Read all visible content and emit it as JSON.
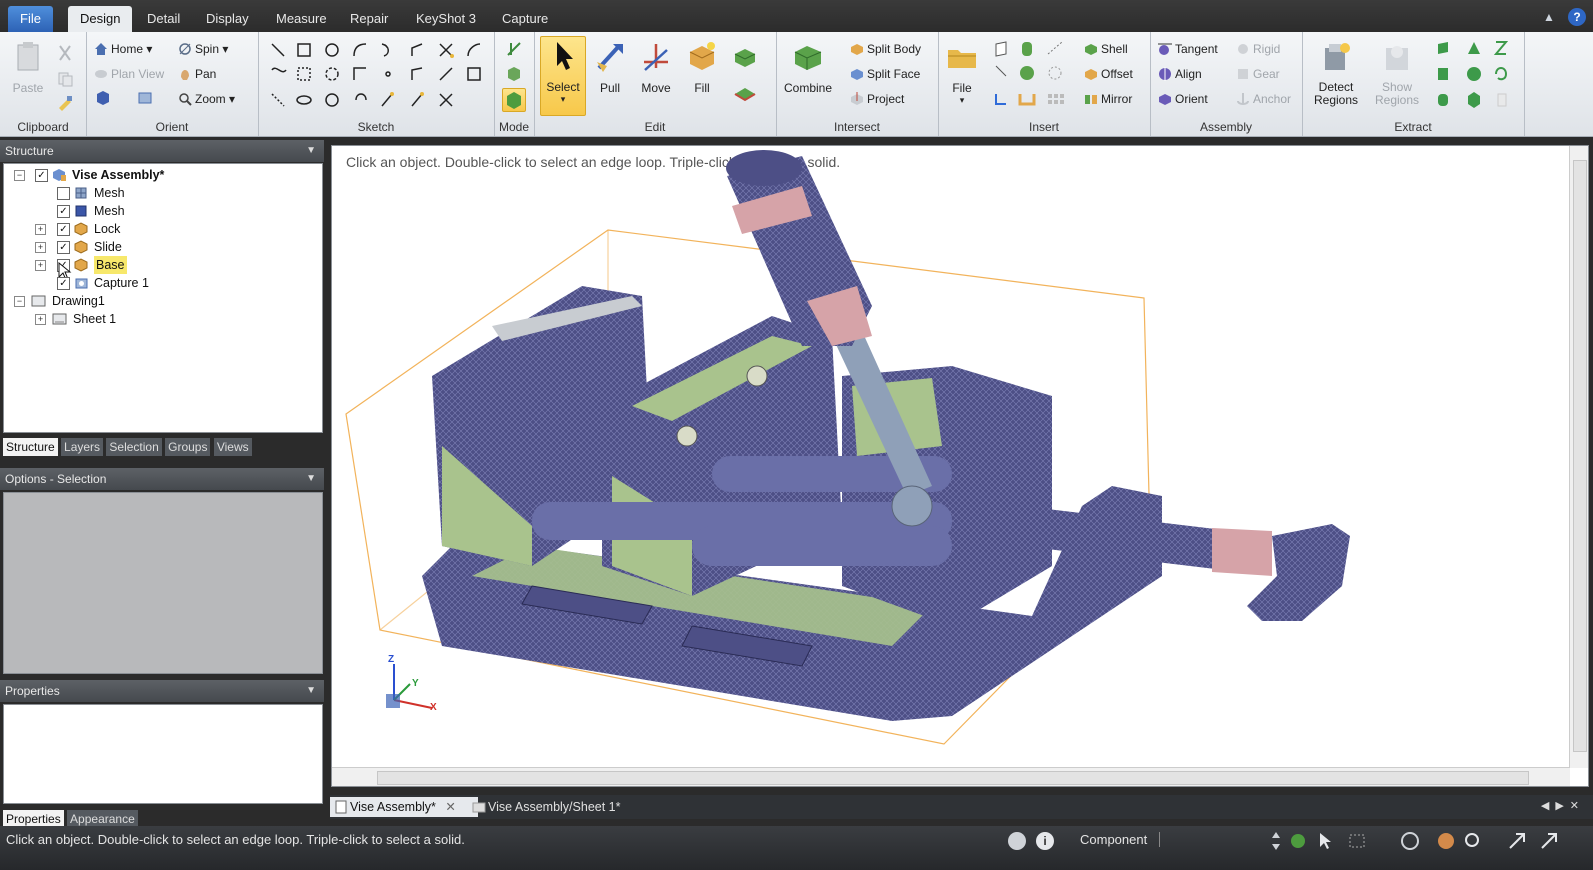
{
  "menu": {
    "tabs": [
      "File",
      "Design",
      "Detail",
      "Display",
      "Measure",
      "Repair",
      "KeyShot 3",
      "Capture"
    ],
    "active": "Design"
  },
  "ribbon": {
    "clipboard": {
      "label": "Clipboard",
      "paste": "Paste"
    },
    "orient": {
      "label": "Orient",
      "home": "Home",
      "spin": "Spin",
      "plan_view": "Plan View",
      "pan": "Pan",
      "zoom": "Zoom"
    },
    "sketch": {
      "label": "Sketch"
    },
    "mode": {
      "label": "Mode"
    },
    "edit": {
      "label": "Edit",
      "select": "Select",
      "pull": "Pull",
      "move": "Move",
      "fill": "Fill"
    },
    "intersect": {
      "label": "Intersect",
      "combine": "Combine",
      "split_body": "Split Body",
      "split_face": "Split Face",
      "project": "Project"
    },
    "insert": {
      "label": "Insert",
      "file": "File",
      "shell": "Shell",
      "offset": "Offset",
      "mirror": "Mirror"
    },
    "assembly": {
      "label": "Assembly",
      "tangent": "Tangent",
      "align": "Align",
      "orient": "Orient",
      "rigid": "Rigid",
      "gear": "Gear",
      "anchor": "Anchor"
    },
    "extract": {
      "label": "Extract",
      "detect_regions": "Detect Regions",
      "show_regions": "Show Regions"
    }
  },
  "structure_panel": {
    "title": "Structure",
    "tree": [
      {
        "label": "Vise Assembly*",
        "bold": true
      },
      {
        "label": "Mesh"
      },
      {
        "label": "Mesh"
      },
      {
        "label": "Lock"
      },
      {
        "label": "Slide"
      },
      {
        "label": "Base",
        "highlighted": true
      },
      {
        "label": "Capture 1"
      },
      {
        "label": "Drawing1"
      },
      {
        "label": "Sheet 1"
      }
    ],
    "tabs": [
      "Structure",
      "Layers",
      "Selection",
      "Groups",
      "Views"
    ]
  },
  "options_panel": {
    "title": "Options - Selection"
  },
  "properties_panel": {
    "title": "Properties",
    "tabs": [
      "Properties",
      "Appearance"
    ]
  },
  "viewport": {
    "hint": "Click an object. Double-click to select an edge loop. Triple-click to select a solid.",
    "axes": {
      "z": "Z",
      "y": "Y",
      "x": "X"
    }
  },
  "doc_tabs": [
    "Vise Assembly*",
    "Vise Assembly/Sheet 1*"
  ],
  "statusbar": {
    "message": "Click an object. Double-click to select an edge loop. Triple-click to select a solid.",
    "filter": "Component"
  },
  "colors": {
    "file_tab": "#2d62b5",
    "highlight": "#f7e86b",
    "mesh": "#4d4f86",
    "solid": "#a9c38d",
    "handle_cap": "#d6a3a8",
    "bbox": "#f2b35b"
  }
}
